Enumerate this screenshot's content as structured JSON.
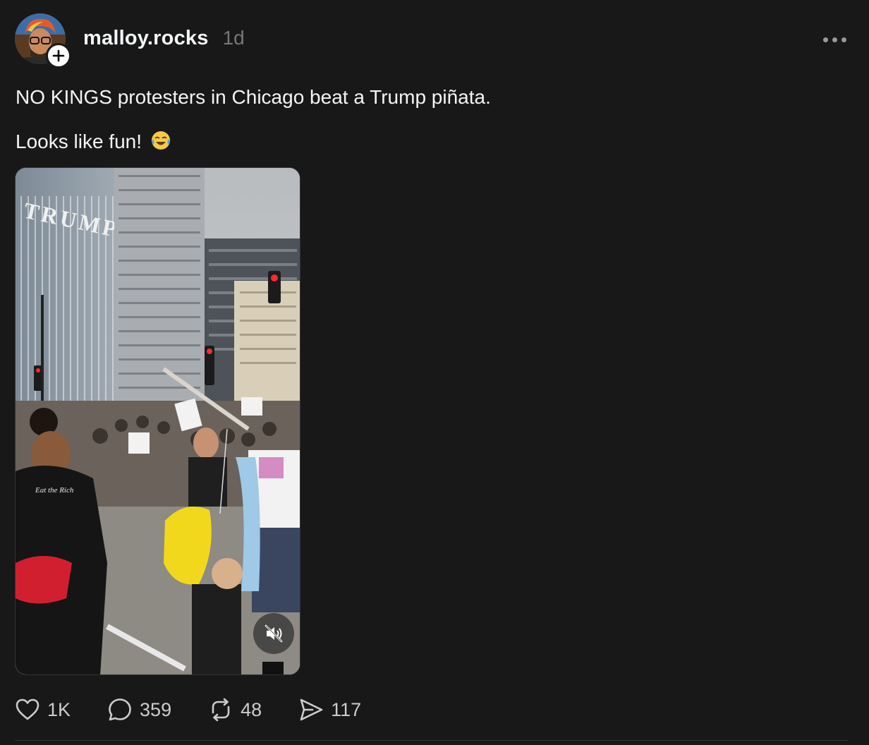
{
  "post": {
    "username": "malloy.rocks",
    "timestamp": "1d",
    "text_line1": "NO KINGS protesters in Chicago beat a Trump piñata.",
    "text_line2": "Looks like fun!",
    "emoji": "face-with-tears-of-joy-icon",
    "media": {
      "building_sign": "TRUMP",
      "shirt_text": "Eat the Rich"
    }
  },
  "actions": {
    "likes": "1K",
    "replies": "359",
    "reposts": "48",
    "shares": "117"
  },
  "colors": {
    "background": "#181818",
    "text": "#f3f5f7",
    "muted": "#777777",
    "icon": "#cccccc"
  }
}
